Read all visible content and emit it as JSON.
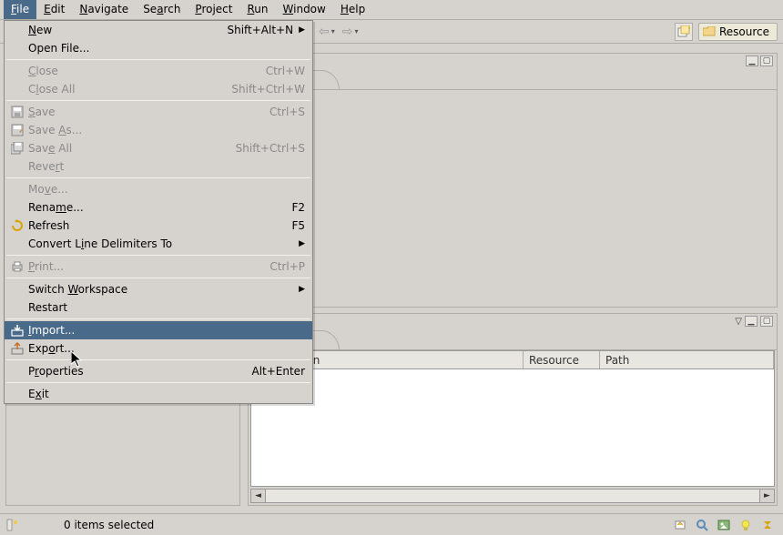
{
  "menubar": [
    {
      "label": "File",
      "u": [
        0
      ],
      "active": true
    },
    {
      "label": "Edit",
      "u": [
        0
      ]
    },
    {
      "label": "Navigate",
      "u": [
        0
      ]
    },
    {
      "label": "Search",
      "u": [
        2
      ]
    },
    {
      "label": "Project",
      "u": [
        0
      ]
    },
    {
      "label": "Run",
      "u": [
        0
      ]
    },
    {
      "label": "Window",
      "u": [
        0
      ]
    },
    {
      "label": "Help",
      "u": [
        0
      ]
    }
  ],
  "toolbar": {
    "resource_label": "Resource"
  },
  "dropdown": {
    "groups": [
      [
        {
          "label": "New",
          "u": [
            0
          ],
          "shortcut": "Shift+Alt+N",
          "submenu": true,
          "disabled": false,
          "icon": null
        },
        {
          "label": "Open File...",
          "disabled": false
        }
      ],
      [
        {
          "label": "Close",
          "u": [
            0
          ],
          "shortcut": "Ctrl+W",
          "disabled": true
        },
        {
          "label": "Close All",
          "u": [
            1
          ],
          "shortcut": "Shift+Ctrl+W",
          "disabled": true
        }
      ],
      [
        {
          "label": "Save",
          "u": [
            0
          ],
          "shortcut": "Ctrl+S",
          "disabled": true,
          "icon": "save"
        },
        {
          "label": "Save As...",
          "u": [
            5
          ],
          "disabled": true,
          "icon": "saveas"
        },
        {
          "label": "Save All",
          "u": [
            3
          ],
          "shortcut": "Shift+Ctrl+S",
          "disabled": true,
          "icon": "saveall"
        },
        {
          "label": "Revert",
          "u": [
            4
          ],
          "disabled": true
        }
      ],
      [
        {
          "label": "Move...",
          "u": [
            2
          ],
          "disabled": true
        },
        {
          "label": "Rename...",
          "u": [
            4
          ],
          "shortcut": "F2",
          "disabled": false
        },
        {
          "label": "Refresh",
          "shortcut": "F5",
          "disabled": false,
          "icon": "refresh"
        },
        {
          "label": "Convert Line Delimiters To",
          "u": [
            9
          ],
          "submenu": true,
          "disabled": false
        }
      ],
      [
        {
          "label": "Print...",
          "u": [
            0
          ],
          "shortcut": "Ctrl+P",
          "disabled": true,
          "icon": "print"
        }
      ],
      [
        {
          "label": "Switch Workspace",
          "u": [
            7
          ],
          "submenu": true,
          "disabled": false
        },
        {
          "label": "Restart",
          "disabled": false
        }
      ],
      [
        {
          "label": "Import...",
          "u": [
            0
          ],
          "disabled": false,
          "selected": true,
          "icon": "import"
        },
        {
          "label": "Export...",
          "u": [
            3
          ],
          "disabled": false,
          "icon": "export"
        }
      ],
      [
        {
          "label": "Properties",
          "u": [
            1
          ],
          "shortcut": "Alt+Enter",
          "disabled": false
        }
      ],
      [
        {
          "label": "Exit",
          "u": [
            1
          ],
          "disabled": false
        }
      ]
    ]
  },
  "table": {
    "headers": {
      "description": "Description",
      "resource": "Resource",
      "path": "Path"
    }
  },
  "status": {
    "text": "0 items selected"
  }
}
